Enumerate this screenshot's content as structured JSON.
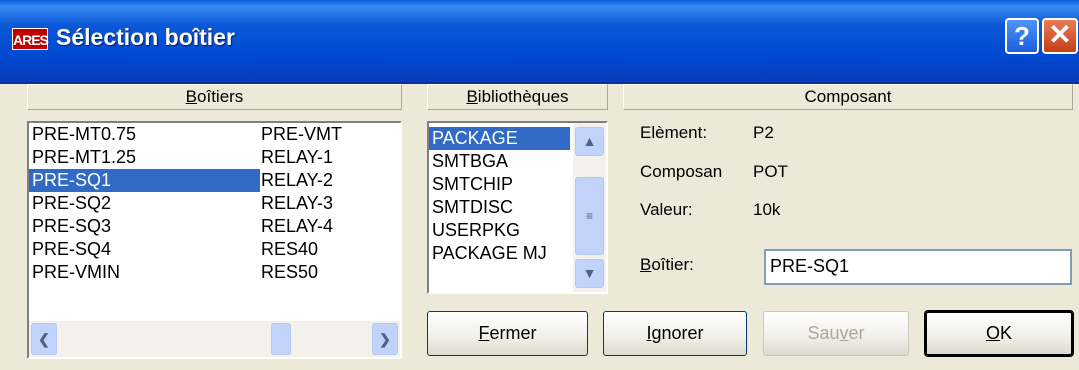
{
  "window": {
    "app_icon_text": "ARES",
    "title": "Sélection boîtier",
    "help_label": "?",
    "close_label": "✕"
  },
  "packages_panel": {
    "header_prefix": "",
    "header_accel": "B",
    "header_rest": "oîtiers",
    "col1": [
      "PRE-MT0.75",
      "PRE-MT1.25",
      "PRE-SQ1",
      "PRE-SQ2",
      "PRE-SQ3",
      "PRE-SQ4",
      "PRE-VMIN"
    ],
    "col2": [
      "PRE-VMT",
      "RELAY-1",
      "RELAY-2",
      "RELAY-3",
      "RELAY-4",
      "RES40",
      "RES50"
    ],
    "selected": "PRE-SQ1"
  },
  "libraries_panel": {
    "header_accel": "B",
    "header_rest": "ibliothèques",
    "items": [
      "PACKAGE",
      "SMTBGA",
      "SMTCHIP",
      "SMTDISC",
      "USERPKG",
      "PACKAGE MJ"
    ],
    "selected": "PACKAGE"
  },
  "component_panel": {
    "header": "Composant",
    "element_label": "Elèment:",
    "element_value": "P2",
    "composant_label": "Composan",
    "composant_value": "POT",
    "valeur_label": "Valeur:",
    "valeur_value": "10k",
    "boitier_label_accel": "B",
    "boitier_label_rest": "oîtier:",
    "boitier_value": "PRE-SQ1"
  },
  "buttons": {
    "close": {
      "accel": "F",
      "rest": "ermer"
    },
    "ignore": {
      "accel": "I",
      "rest": "gnorer"
    },
    "save": {
      "pre": "Sau",
      "accel": "v",
      "rest": "er"
    },
    "ok": {
      "accel": "O",
      "rest": "K"
    }
  },
  "icons": {
    "scroll_up": "chevron-up-icon",
    "scroll_down": "chevron-down-icon",
    "scroll_left": "chevron-left-icon",
    "scroll_right": "chevron-right-icon"
  },
  "colors": {
    "title_bar": "#0054e3",
    "selection": "#316ac5",
    "dialog_bg": "#ece9d8"
  }
}
